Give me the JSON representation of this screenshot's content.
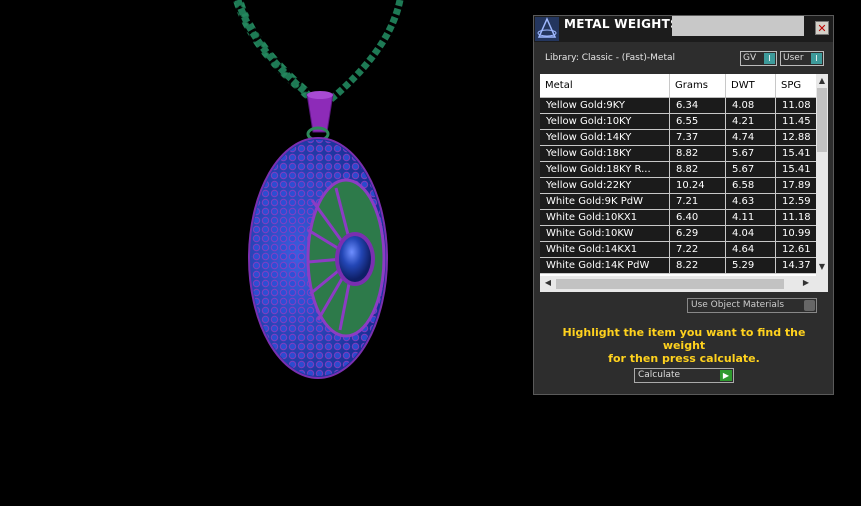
{
  "panel": {
    "title": "METAL WEIGHTS",
    "library_label": "Library: Classic - (Fast)-Metal",
    "gv_label": "GV",
    "user_label": "User",
    "toggle_knob": "I",
    "close_glyph": "✕"
  },
  "table": {
    "headers": [
      "Metal",
      "Grams",
      "DWT",
      "SPG"
    ],
    "rows": [
      [
        "Yellow Gold:9KY",
        "6.34",
        "4.08",
        "11.08"
      ],
      [
        "Yellow Gold:10KY",
        "6.55",
        "4.21",
        "11.45"
      ],
      [
        "Yellow Gold:14KY",
        "7.37",
        "4.74",
        "12.88"
      ],
      [
        "Yellow Gold:18KY",
        "8.82",
        "5.67",
        "15.41"
      ],
      [
        "Yellow Gold:18KY R...",
        "8.82",
        "5.67",
        "15.41"
      ],
      [
        "Yellow Gold:22KY",
        "10.24",
        "6.58",
        "17.89"
      ],
      [
        "White Gold:9K PdW",
        "7.21",
        "4.63",
        "12.59"
      ],
      [
        "White Gold:10KX1",
        "6.40",
        "4.11",
        "11.18"
      ],
      [
        "White Gold:10KW",
        "6.29",
        "4.04",
        "10.99"
      ],
      [
        "White Gold:14KX1",
        "7.22",
        "4.64",
        "12.61"
      ],
      [
        "White Gold:14K PdW",
        "8.22",
        "5.29",
        "14.37"
      ]
    ]
  },
  "use_object_materials": "Use Object Materials",
  "hint_line1": "Highlight the item you want to find the weight",
  "hint_line2": "for then press calculate.",
  "calculate_label": "Calculate",
  "colors": {
    "chain": "#1e7a55",
    "bail": "#8d2bb8",
    "stones": "#2446c8",
    "prongs": "#9a3fc0",
    "center_stone": "#1d3fa8",
    "hint_text": "#ffd21e"
  }
}
